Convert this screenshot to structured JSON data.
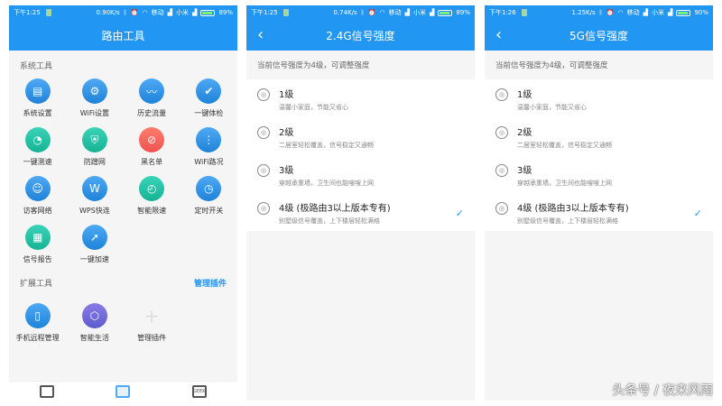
{
  "colors": {
    "accent": "#2196f3",
    "battery": "#7cf07c"
  },
  "phones": [
    {
      "status": {
        "time": "下午1:25",
        "speed": "0.90K/s",
        "carrier1": "移动",
        "carrier2": "小米",
        "battery": "89%",
        "battery_level": 0.89
      }
    },
    {
      "status": {
        "time": "下午1:25",
        "speed": "0.74K/s",
        "carrier1": "移动",
        "carrier2": "小米",
        "battery": "89%",
        "battery_level": 0.89
      }
    },
    {
      "status": {
        "time": "下午1:26",
        "speed": "1.25K/s",
        "carrier1": "移动",
        "carrier2": "小米",
        "battery": "90%",
        "battery_level": 0.9
      }
    }
  ],
  "tools_screen": {
    "title": "路由工具",
    "system_section": "系统工具",
    "tools": [
      {
        "label": "系统设置",
        "icon": "router-icon",
        "color": "blue"
      },
      {
        "label": "WiFi设置",
        "icon": "gear-icon",
        "color": "blue"
      },
      {
        "label": "历史流量",
        "icon": "line-chart-icon",
        "color": "blue"
      },
      {
        "label": "一键体检",
        "icon": "shield-check-icon",
        "color": "blue"
      },
      {
        "label": "一键测速",
        "icon": "speedometer-icon",
        "color": "teal"
      },
      {
        "label": "防蹭网",
        "icon": "shield-icon",
        "color": "teal"
      },
      {
        "label": "黑名单",
        "icon": "wifi-block-icon",
        "color": "red"
      },
      {
        "label": "WiFi路况",
        "icon": "traffic-light-icon",
        "color": "blue"
      },
      {
        "label": "访客网络",
        "icon": "guest-icon",
        "color": "blue"
      },
      {
        "label": "WPS快连",
        "icon": "wps-icon",
        "color": "blue"
      },
      {
        "label": "智能限速",
        "icon": "gauge-icon",
        "color": "teal"
      },
      {
        "label": "定时开关",
        "icon": "timer-icon",
        "color": "blue"
      },
      {
        "label": "信号报告",
        "icon": "report-icon",
        "color": "teal"
      },
      {
        "label": "一键加速",
        "icon": "rocket-icon",
        "color": "blue"
      }
    ],
    "ext_section": "扩展工具",
    "manage_link": "管理插件",
    "ext_tools": [
      {
        "label": "手机远程管理",
        "icon": "phone-remote-icon",
        "color": "blue"
      },
      {
        "label": "智能生活",
        "icon": "smart-home-icon",
        "color": "purple"
      },
      {
        "label": "管理插件",
        "icon": "plus-icon",
        "color": "ghost"
      }
    ],
    "tabbar": {
      "geek": "GEEK"
    }
  },
  "signal_screens": [
    {
      "title": "2.4G信号强度",
      "notice": "当前信号强度为4级，可调整强度",
      "levels": [
        {
          "title": "1级",
          "desc": "温馨小家庭，节能又省心",
          "icon": "1"
        },
        {
          "title": "2级",
          "desc": "二居室轻松覆盖，信号稳定又通畅",
          "icon": "2"
        },
        {
          "title": "3级",
          "desc": "穿越承重墙，卫生间也能嗖嗖上网",
          "icon": "3"
        },
        {
          "title": "4级 (极路由3以上版本专有)",
          "desc": "别墅级信号覆盖，上下楼层轻松满格",
          "icon": "4",
          "selected": true
        }
      ]
    },
    {
      "title": "5G信号强度",
      "notice": "当前信号强度为4级，可调整强度",
      "levels": [
        {
          "title": "1级",
          "desc": "温馨小家庭，节能又省心",
          "icon": "1"
        },
        {
          "title": "2级",
          "desc": "二居室轻松覆盖，信号稳定又通畅",
          "icon": "2"
        },
        {
          "title": "3级",
          "desc": "穿越承重墙，卫生间也能嗖嗖上网",
          "icon": "3"
        },
        {
          "title": "4级 (极路由3以上版本专有)",
          "desc": "别墅级信号覆盖，上下楼层轻松满格",
          "icon": "4",
          "selected": true
        }
      ]
    }
  ],
  "watermark": "头条号 / 夜来风雨"
}
